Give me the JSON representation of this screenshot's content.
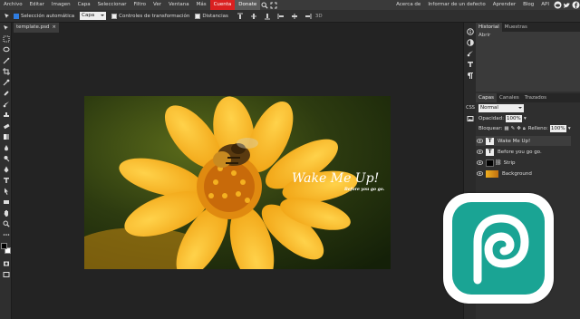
{
  "menu": {
    "items": [
      "Archivo",
      "Editar",
      "Imagen",
      "Capa",
      "Seleccionar",
      "Filtro",
      "Ver",
      "Ventana",
      "Más"
    ],
    "account": "Cuenta",
    "donate": "Donate",
    "right_links": [
      "Acerca de",
      "Informar de un defecto",
      "Aprender",
      "Blog",
      "API"
    ]
  },
  "options": {
    "auto_select_label": "Selección automática",
    "auto_select_checked": true,
    "target_value": "Capa",
    "transform_controls_label": "Controles de transformación",
    "distances_label": "Distancias",
    "zoom_label": "3D"
  },
  "document": {
    "tab_name": "template.psd",
    "close_glyph": "×",
    "title_text": "Wake Me Up!",
    "subtitle_text": "Before you go go."
  },
  "history_panel": {
    "tabs": [
      "Historial",
      "Muestras"
    ],
    "items": [
      "Abrir"
    ]
  },
  "layers_panel": {
    "tabs": [
      "Capas",
      "Canales",
      "Trazados"
    ],
    "blend_mode": "Normal",
    "opacity_label": "Opacidad:",
    "opacity_value": "100%",
    "lock_label": "Bloquear:",
    "fill_label": "Relleno:",
    "fill_value": "100%",
    "layers": [
      "Wake Me Up!",
      "Before you go go.",
      "Strip",
      "Background"
    ]
  },
  "colors": {
    "accent_red": "#d92020",
    "logo_teal": "#1aa494",
    "checkbox_blue": "#2f7de1"
  },
  "icons": {
    "search": "search-icon",
    "reddit": "reddit-icon",
    "twitter": "twitter-icon",
    "facebook": "facebook-icon",
    "eye": "eye-icon",
    "logo": "photopea-logo"
  }
}
